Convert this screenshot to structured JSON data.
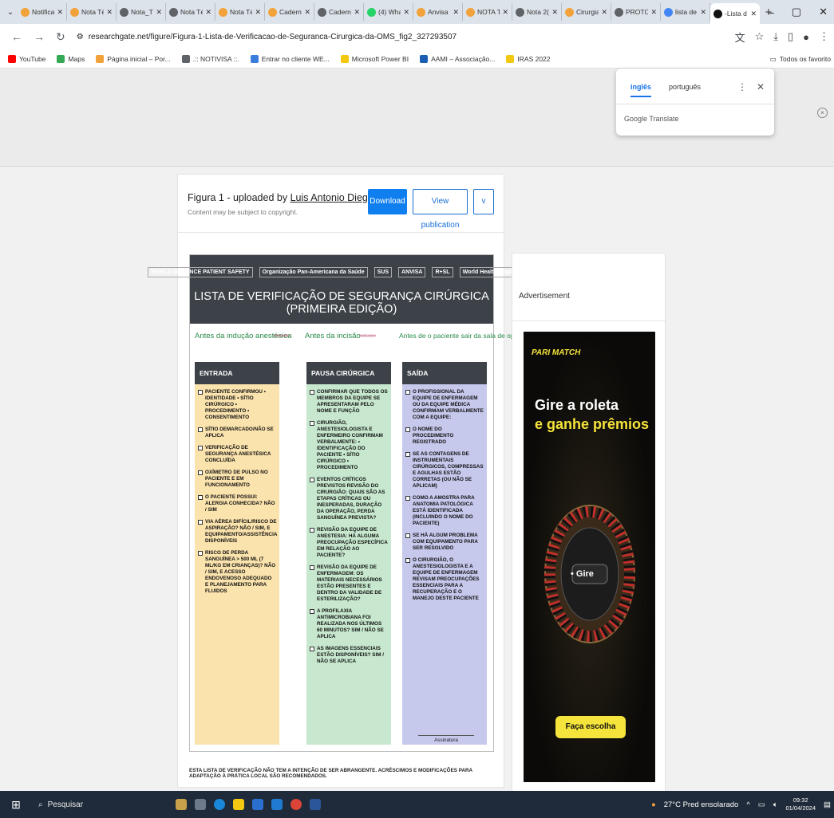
{
  "tabs": [
    {
      "label": "Notifica",
      "color": "#f2a23a"
    },
    {
      "label": "Nota Té",
      "color": "#f2a23a"
    },
    {
      "label": "Nota_Té",
      "color": "#5f6368"
    },
    {
      "label": "Nota Té",
      "color": "#5f6368"
    },
    {
      "label": "Nota Té",
      "color": "#f2a23a"
    },
    {
      "label": "Cadern",
      "color": "#f2a23a"
    },
    {
      "label": "Cadern",
      "color": "#5f6368"
    },
    {
      "label": "(4) Wha",
      "color": "#25d366"
    },
    {
      "label": "Anvisa",
      "color": "#f2a23a"
    },
    {
      "label": "NOTA T",
      "color": "#f2a23a"
    },
    {
      "label": "Nota 2(",
      "color": "#5f6368"
    },
    {
      "label": "Cirurgia",
      "color": "#f2a23a"
    },
    {
      "label": "PROTO",
      "color": "#5f6368"
    },
    {
      "label": "lista de",
      "color": "#4285f4"
    },
    {
      "label": "-Lista d",
      "color": "#111111",
      "active": true
    }
  ],
  "address": {
    "url": "researchgate.net/figure/Figura-1-Lista-de-Verificacao-de-Seguranca-Cirurgica-da-OMS_fig2_327293507"
  },
  "bookmarks": [
    {
      "label": "YouTube",
      "color": "#ff0000"
    },
    {
      "label": "Maps",
      "color": "#34a853"
    },
    {
      "label": "Página inicial – Por...",
      "color": "#f2a23a"
    },
    {
      "label": ".:: NOTIVISA ::.",
      "color": "#5f6368"
    },
    {
      "label": "Entrar no cliente WE...",
      "color": "#3b7ddd"
    },
    {
      "label": "Microsoft Power BI",
      "color": "#f2c811"
    },
    {
      "label": "AAMI – Associação...",
      "color": "#1a5fb4"
    },
    {
      "label": "IRAS 2022",
      "color": "#f2c811"
    }
  ],
  "bookmarks_right": "Todos os favorito",
  "translate": {
    "lang1": "inglês",
    "lang2": "português",
    "brand": "Google Translate"
  },
  "card": {
    "title_prefix": "Figura 1 - uploaded by ",
    "author": "Luis Antonio Diego",
    "subtitle": "Content may be subject to copyright.",
    "download": "Download",
    "view": "View publication",
    "more": "v"
  },
  "figure": {
    "logos": [
      "WORLD ALLIANCE PATIENT SAFETY",
      "Organização Pan-Americana da Saúde",
      "SUS",
      "ANVISA",
      "R+SL",
      "World Health Organization"
    ],
    "title": "LISTA DE VERIFICAÇÃO DE SEGURANÇA CIRÚRGICA (PRIMEIRA EDIÇÃO)",
    "phase1": "Antes da indução anestésica",
    "phase2": "Antes da incisão",
    "phase3": "Antes de o paciente sair da sala de operações",
    "arrows": "»»»»»»»",
    "col1": {
      "head": "ENTRADA",
      "items": [
        "PACIENTE CONFIRMOU • IDENTIDADE • SÍTIO CIRÚRGICO • PROCEDIMENTO • CONSENTIMENTO",
        "SÍTIO DEMARCADO/NÃO SE APLICA",
        "VERIFICAÇÃO DE SEGURANÇA ANESTÉSICA CONCLUÍDA",
        "OXÍMETRO DE PULSO NO PACIENTE E EM FUNCIONAMENTO",
        "O PACIENTE POSSUI: ALERGIA CONHECIDA? NÃO / SIM",
        "VIA AÉREA DIFÍCIL/RISCO DE ASPIRAÇÃO? NÃO / SIM, E EQUIPAMENTO/ASSISTÊNCIA DISPONÍVEIS",
        "RISCO DE PERDA SANGUÍNEA > 500 ML (7 ML/KG EM CRIANÇAS)? NÃO / SIM, E ACESSO ENDOVENOSO ADEQUADO E PLANEJAMENTO PARA FLUIDOS"
      ]
    },
    "col2": {
      "head": "PAUSA CIRÚRGICA",
      "items": [
        "CONFIRMAR QUE TODOS OS MEMBROS DA EQUIPE SE APRESENTARAM PELO NOME E FUNÇÃO",
        "CIRURGIÃO, ANESTESIOLOGISTA E ENFERMEIRO CONFIRMAM VERBALMENTE: • IDENTIFICAÇÃO DO PACIENTE • SÍTIO CIRÚRGICO • PROCEDIMENTO",
        "EVENTOS CRÍTICOS PREVISTOS REVISÃO DO CIRURGIÃO: QUAIS SÃO AS ETAPAS CRÍTICAS OU INESPERADAS, DURAÇÃO DA OPERAÇÃO, PERDA SANGUÍNEA PREVISTA?",
        "REVISÃO DA EQUIPE DE ANESTESIA: HÁ ALGUMA PREOCUPAÇÃO ESPECÍFICA EM RELAÇÃO AO PACIENTE?",
        "REVISÃO DA EQUIPE DE ENFERMAGEM: OS MATERIAIS NECESSÁRIOS ESTÃO PRESENTES E DENTRO DA VALIDADE DE ESTERILIZAÇÃO?",
        "A PROFILAXIA ANTIMICROBIANA FOI REALIZADA NOS ÚLTIMOS 60 MINUTOS? SIM / NÃO SE APLICA",
        "AS IMAGENS ESSENCIAIS ESTÃO DISPONÍVEIS? SIM / NÃO SE APLICA"
      ]
    },
    "col3": {
      "head": "SAÍDA",
      "items": [
        "O PROFISSIONAL DA EQUIPE DE ENFERMAGEM OU DA EQUIPE MÉDICA CONFIRMAM VERBALMENTE COM A EQUIPE:",
        "O NOME DO PROCEDIMENTO REGISTRADO",
        "SE AS CONTAGENS DE INSTRUMENTAIS CIRÚRGICOS, COMPRESSAS E AGULHAS ESTÃO CORRETAS (OU NÃO SE APLICAM)",
        "COMO A AMOSTRA PARA ANATOMIA PATOLÓGICA ESTÁ IDENTIFICADA (INCLUINDO O NOME DO PACIENTE)",
        "SE HÁ ALGUM PROBLEMA COM EQUIPAMENTO PARA SER RESOLVIDO",
        "O CIRURGIÃO, O ANESTESIOLOGISTA E A EQUIPE DE ENFERMAGEM REVISAM PREOCUPAÇÕES ESSENCIAIS PARA A RECUPERAÇÃO E O MANEJO DESTE PACIENTE"
      ],
      "sign": "Assinatura"
    },
    "footer": "ESTA LISTA DE VERIFICAÇÃO NÃO TEM A INTENÇÃO DE SER ABRANGENTE. ACRÉSCIMOS E MODIFICAÇÕES PARA ADAPTAÇÃO À PRÁTICA LOCAL SÃO RECOMENDADOS."
  },
  "ad": {
    "label": "Advertisement",
    "brand": "PARI MATCH",
    "headline1": "Gire a roleta",
    "headline2": "e ganhe prêmios",
    "wheel_label": "• Gire",
    "cta": "Faça escolha"
  },
  "taskbar": {
    "search": "Pesquisar",
    "weather": "27°C Pred ensolarado",
    "time": "09:32",
    "date": "01/04/2024"
  }
}
